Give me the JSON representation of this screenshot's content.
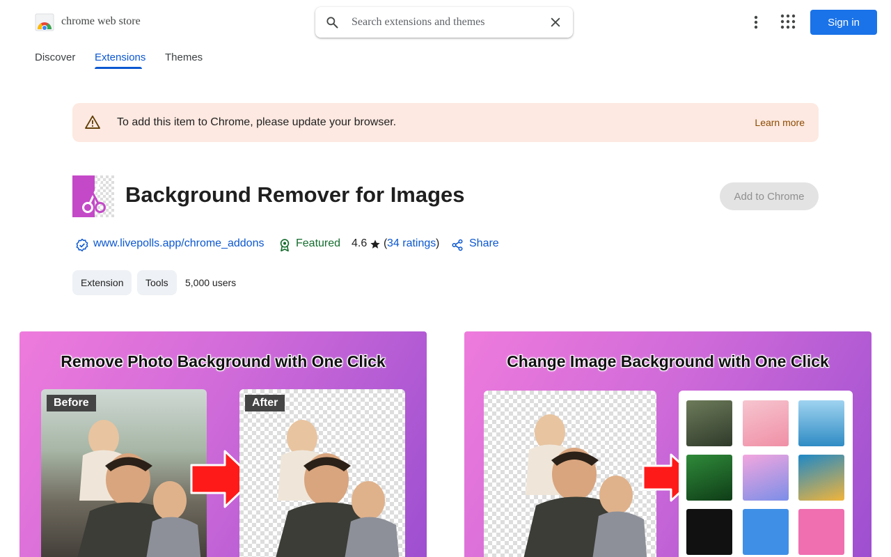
{
  "header": {
    "brand": "chrome web store",
    "search_placeholder": "Search extensions and themes",
    "signin_label": "Sign in"
  },
  "tabs": [
    {
      "label": "Discover",
      "active": false
    },
    {
      "label": "Extensions",
      "active": true
    },
    {
      "label": "Themes",
      "active": false
    }
  ],
  "banner": {
    "message": "To add this item to Chrome, please update your browser.",
    "link": "Learn more"
  },
  "item": {
    "title": "Background Remover for Images",
    "add_button": "Add to Chrome",
    "site": "www.livepolls.app/chrome_addons",
    "featured": "Featured",
    "rating": "4.6",
    "ratings_link": "34 ratings",
    "share": "Share",
    "chips": [
      "Extension",
      "Tools"
    ],
    "users": "5,000 users"
  },
  "screenshots": [
    {
      "caption": "Remove Photo Background with One Click",
      "before_tag": "Before",
      "after_tag": "After"
    },
    {
      "caption": "Change Image Background with One Click"
    }
  ],
  "colors": {
    "accent": "#0b57d0",
    "signin": "#1a73e8",
    "banner_bg": "#fde9e1",
    "featured": "#146c2e"
  }
}
